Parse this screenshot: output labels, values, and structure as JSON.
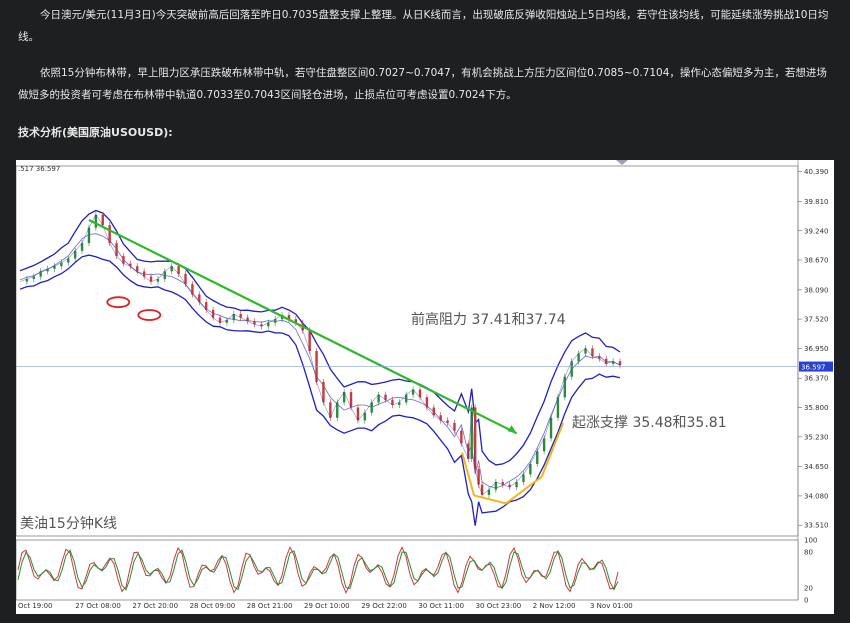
{
  "paragraphs": [
    "今日澳元/美元(11月3日)今天突破前高后回落至昨日0.7035盘整支撑上整理。从日K线而言，出现破底反弹收阳烛站上5日均线，若守住该均线，可能延续涨势挑战10日均线。",
    "依照15分钟布林带，早上阻力区承压跌破布林带中轨，若守住盘整区间0.7027~0.7047，有机会挑战上方压力区间位0.7085~0.7104，操作心态偏短多为主，若想进场做短多的投资者可考虑在布林带中轨道0.7033至0.7043区间轻仓进场，止损点位可考虑设置0.7024下方。"
  ],
  "heading": "技术分析(美国原油USOUSD):",
  "chart_data": {
    "type": "line",
    "instrument_label": "美油15分钟K线",
    "header_values": ".517  36.597",
    "current_price": "36.597",
    "y_ticks": [
      "40.390",
      "39.810",
      "39.240",
      "38.670",
      "38.090",
      "37.520",
      "36.950",
      "36.370",
      "35.800",
      "35.230",
      "34.650",
      "34.080",
      "33.510"
    ],
    "ylim": [
      33.3,
      40.5
    ],
    "x_ticks": [
      "Oct 19:00",
      "27 Oct 08:00",
      "27 Oct 20:00",
      "28 Oct 09:00",
      "28 Oct 21:00",
      "29 Oct 10:00",
      "29 Oct 22:00",
      "30 Oct 11:00",
      "30 Oct 23:00",
      "2 Nov 12:00",
      "3 Nov 01:00"
    ],
    "osc_ticks": [
      "100",
      "80",
      "20",
      "0"
    ],
    "annotations": {
      "resistance": "前高阻力 37.41和37.74",
      "support": "起涨支撑 35.48和35.81"
    },
    "price": [
      [
        0,
        38.25
      ],
      [
        4,
        38.3
      ],
      [
        8,
        38.35
      ],
      [
        12,
        38.45
      ],
      [
        16,
        38.5
      ],
      [
        20,
        38.55
      ],
      [
        24,
        38.62
      ],
      [
        28,
        38.7
      ],
      [
        32,
        38.85
      ],
      [
        36,
        39.0
      ],
      [
        40,
        39.3
      ],
      [
        44,
        39.55
      ],
      [
        48,
        39.35
      ],
      [
        52,
        39.0
      ],
      [
        56,
        38.75
      ],
      [
        60,
        38.6
      ],
      [
        64,
        38.55
      ],
      [
        68,
        38.45
      ],
      [
        72,
        38.35
      ],
      [
        76,
        38.25
      ],
      [
        80,
        38.3
      ],
      [
        84,
        38.45
      ],
      [
        88,
        38.55
      ],
      [
        92,
        38.4
      ],
      [
        96,
        38.2
      ],
      [
        100,
        38.0
      ],
      [
        104,
        37.85
      ],
      [
        108,
        37.7
      ],
      [
        112,
        37.55
      ],
      [
        116,
        37.45
      ],
      [
        120,
        37.5
      ],
      [
        124,
        37.62
      ],
      [
        128,
        37.55
      ],
      [
        132,
        37.48
      ],
      [
        136,
        37.42
      ],
      [
        140,
        37.38
      ],
      [
        144,
        37.45
      ],
      [
        148,
        37.52
      ],
      [
        152,
        37.6
      ],
      [
        156,
        37.52
      ],
      [
        160,
        37.45
      ],
      [
        164,
        37.3
      ],
      [
        168,
        36.9
      ],
      [
        172,
        36.3
      ],
      [
        176,
        35.9
      ],
      [
        180,
        35.6
      ],
      [
        184,
        35.9
      ],
      [
        188,
        36.1
      ],
      [
        192,
        35.8
      ],
      [
        196,
        35.55
      ],
      [
        200,
        35.7
      ],
      [
        204,
        35.9
      ],
      [
        208,
        36.05
      ],
      [
        212,
        35.95
      ],
      [
        216,
        35.85
      ],
      [
        220,
        35.9
      ],
      [
        224,
        36.05
      ],
      [
        228,
        36.15
      ],
      [
        232,
        36.0
      ],
      [
        236,
        35.8
      ],
      [
        240,
        35.65
      ],
      [
        244,
        35.55
      ],
      [
        248,
        35.5
      ],
      [
        252,
        35.35
      ],
      [
        256,
        35.1
      ],
      [
        260,
        34.8
      ],
      [
        262,
        35.8
      ],
      [
        264,
        34.6
      ],
      [
        266,
        34.3
      ],
      [
        268,
        34.1
      ],
      [
        272,
        34.2
      ],
      [
        276,
        34.35
      ],
      [
        280,
        34.3
      ],
      [
        284,
        34.25
      ],
      [
        288,
        34.35
      ],
      [
        292,
        34.5
      ],
      [
        296,
        34.7
      ],
      [
        300,
        34.95
      ],
      [
        304,
        35.2
      ],
      [
        308,
        35.6
      ],
      [
        312,
        36.0
      ],
      [
        316,
        36.4
      ],
      [
        320,
        36.7
      ],
      [
        324,
        36.85
      ],
      [
        328,
        36.95
      ],
      [
        332,
        36.8
      ],
      [
        336,
        36.75
      ],
      [
        340,
        36.65
      ],
      [
        344,
        36.7
      ],
      [
        348,
        36.62
      ]
    ],
    "band_width": [
      0.18,
      0.18,
      0.2,
      0.2,
      0.22,
      0.22,
      0.25,
      0.25,
      0.3,
      0.35,
      0.4,
      0.45,
      0.45,
      0.4,
      0.35,
      0.3,
      0.28,
      0.25,
      0.25,
      0.25,
      0.25,
      0.28,
      0.3,
      0.3,
      0.3,
      0.3,
      0.28,
      0.25,
      0.25,
      0.22,
      0.22,
      0.22,
      0.2,
      0.2,
      0.2,
      0.2,
      0.2,
      0.22,
      0.25,
      0.25,
      0.3,
      0.4,
      0.55,
      0.65,
      0.6,
      0.55,
      0.5,
      0.45,
      0.45,
      0.45,
      0.45,
      0.45,
      0.4,
      0.38,
      0.35,
      0.35,
      0.35,
      0.35,
      0.35,
      0.35,
      0.38,
      0.4,
      0.42,
      0.5,
      0.6,
      0.8,
      1.1,
      1.0,
      0.8,
      0.6,
      0.5,
      0.45,
      0.42,
      0.4,
      0.45,
      0.5,
      0.55,
      0.6,
      0.62,
      0.65,
      0.65,
      0.6,
      0.55,
      0.5,
      0.45,
      0.4,
      0.35,
      0.3,
      0.28,
      0.25
    ],
    "trendline": {
      "from": [
        40,
        39.45
      ],
      "to": [
        288,
        35.3
      ]
    },
    "red_circles": [
      [
        57,
        37.85
      ],
      [
        75,
        37.6
      ]
    ],
    "support_arrows": {
      "start": [
        268,
        34.05
      ],
      "end": [
        298,
        34.3
      ]
    }
  },
  "colors": {
    "price": "#1a1aa8",
    "band": "#2020c0",
    "trend": "#2db82d",
    "circle": "#e02020",
    "arrow": "#f2b61c",
    "osc_red": "#d03a3a",
    "osc_green": "#2a8a3a",
    "current": "#2840d0"
  }
}
